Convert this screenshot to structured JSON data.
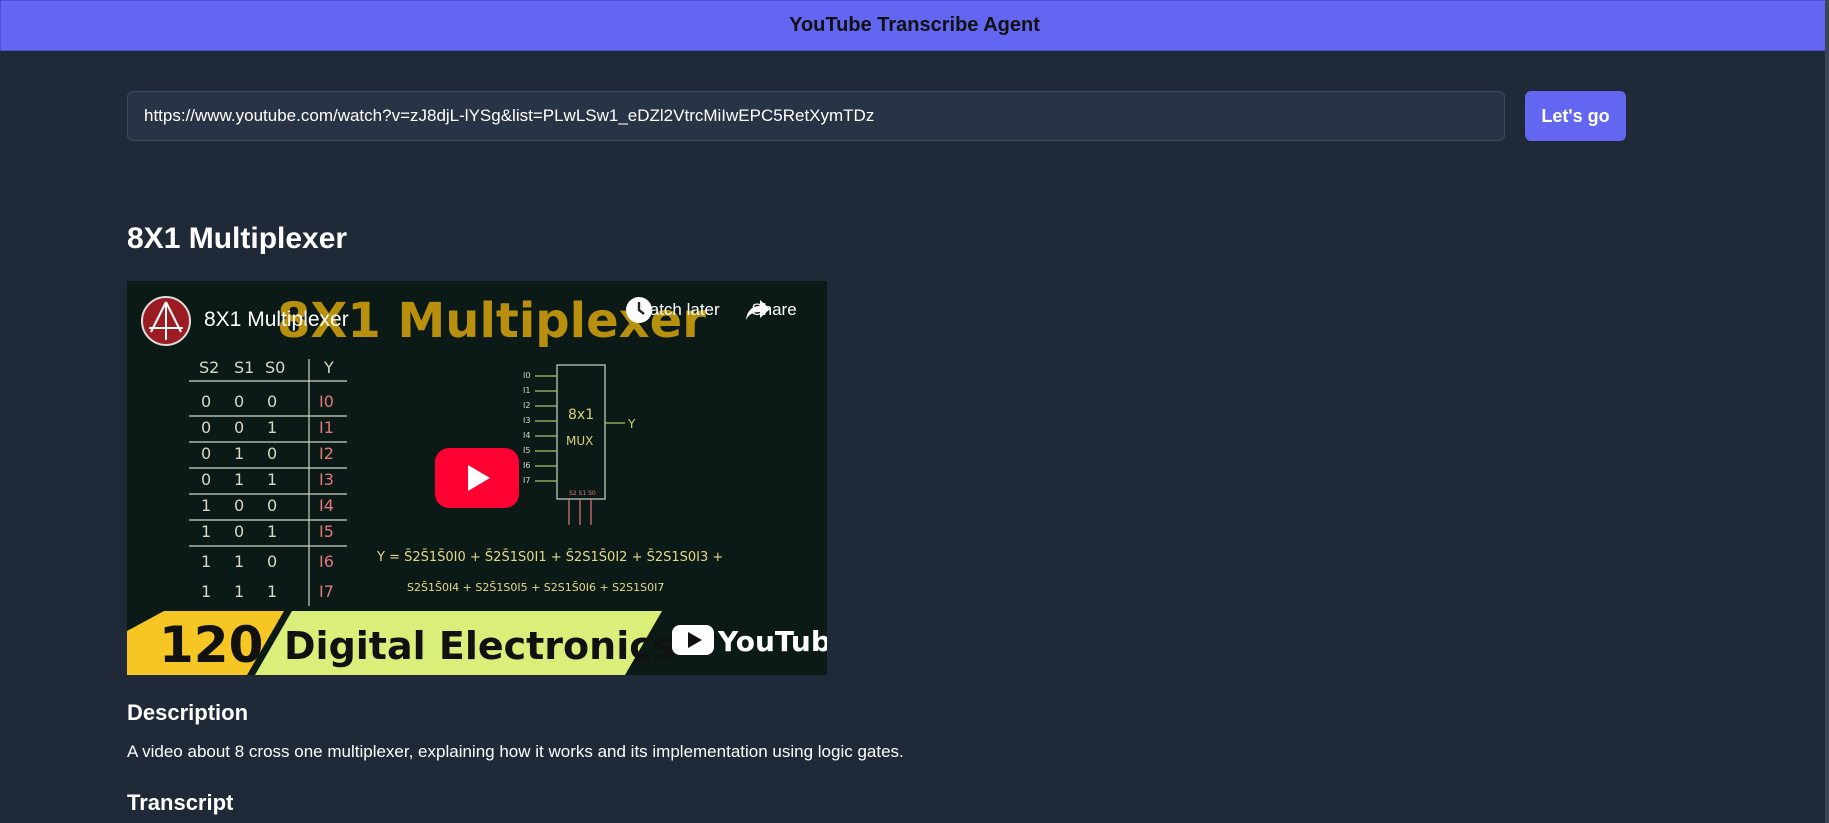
{
  "header": {
    "title": "YouTube Transcribe Agent"
  },
  "url_input": {
    "value": "https://www.youtube.com/watch?v=zJ8djL-lYSg&list=PLwLSw1_eDZl2VtrcMiIwEPC5RetXymTDz"
  },
  "go_button": {
    "label": "Let's go"
  },
  "video": {
    "title": "8X1 Multiplexer",
    "player": {
      "overlay_title": "8X1 Multiplexer",
      "watch_later_label": "Watch later",
      "share_label": "Share",
      "thumbnail": {
        "banner_title": "8X1 Multiplexer",
        "episode_number": "120",
        "series_name": "Digital Electronics",
        "brand": "YouTube",
        "table_headers": [
          "S2",
          "S1",
          "S0",
          "Y"
        ],
        "table_rows": [
          [
            "0",
            "0",
            "0",
            "I0"
          ],
          [
            "0",
            "0",
            "1",
            "I1"
          ],
          [
            "0",
            "1",
            "0",
            "I2"
          ],
          [
            "0",
            "1",
            "1",
            "I3"
          ],
          [
            "1",
            "0",
            "0",
            "I4"
          ],
          [
            "1",
            "0",
            "1",
            "I5"
          ],
          [
            "1",
            "1",
            "0",
            "I6"
          ],
          [
            "1",
            "1",
            "1",
            "I7"
          ]
        ],
        "mux_label_line1": "8x1",
        "mux_label_line2": "MUX",
        "mux_inputs": [
          "I0",
          "I1",
          "I2",
          "I3",
          "I4",
          "I5",
          "I6",
          "I7"
        ],
        "mux_output": "Y",
        "mux_selects": "S2 S1 S0",
        "equation_line1": "Y = S̄2S̄1S̄0I0 + S̄2S̄1S0I1 + S̄2S1S̄0I2 + S̄2S1S0I3 +",
        "equation_line2": "S2S̄1S̄0I4 + S2S̄1S0I5 + S2S1S̄0I6 + S2S1S0I7"
      }
    }
  },
  "description": {
    "heading": "Description",
    "text": "A video about 8 cross one multiplexer, explaining how it works and its implementation using logic gates."
  },
  "transcript": {
    "heading": "Transcript"
  },
  "colors": {
    "header_bg": "#6366f1",
    "page_bg": "#1f2937",
    "input_bg": "#283445",
    "button_bg": "#6366f1",
    "play_button": "#ff0033",
    "banner_yellow": "#f6c624",
    "banner_green": "#d9ef7a"
  }
}
